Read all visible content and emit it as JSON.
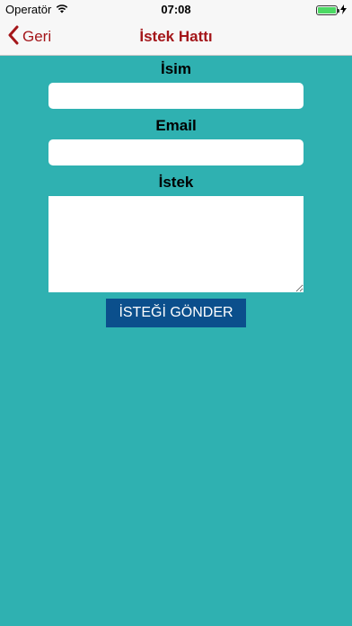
{
  "status_bar": {
    "carrier": "Operatör",
    "time": "07:08",
    "wifi_icon": "wifi-icon",
    "charging_icon": "bolt-icon",
    "battery_color": "#4cd964"
  },
  "nav": {
    "back_label": "Geri",
    "title": "İstek Hattı",
    "accent_color": "#a4161a"
  },
  "form": {
    "name_label": "İsim",
    "email_label": "Email",
    "request_label": "İstek",
    "name_value": "",
    "email_value": "",
    "request_value": "",
    "submit_label": "İSTEĞİ GÖNDER",
    "submit_color": "#0b4f8c",
    "background_color": "#2fb1b1"
  }
}
